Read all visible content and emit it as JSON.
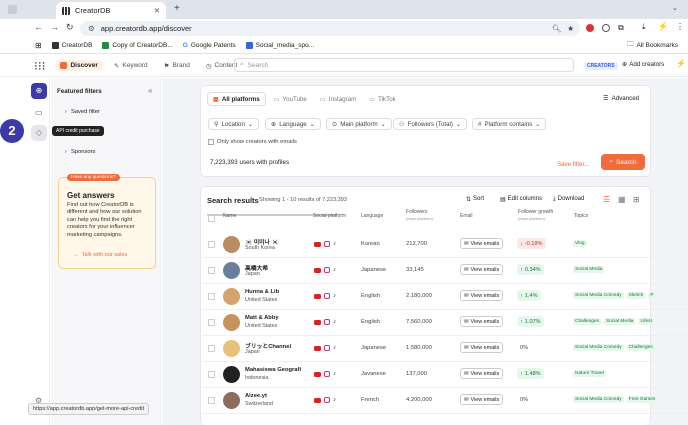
{
  "browser": {
    "tab_title": "CreatorDB",
    "new_tab": "+",
    "url": "app.creatordb.app/discover",
    "bookmarks": [
      "CreatorDB",
      "Copy of CreatorDB...",
      "Google Patents",
      "Social_media_spo..."
    ],
    "all_bookmarks": "All Bookmarks"
  },
  "nav": {
    "discover": "Discover",
    "keyword": "Keyword",
    "brand": "Brand",
    "content": "Content",
    "search_placeholder": "Search",
    "badge": "CREATORS",
    "add_creators": "Add creators"
  },
  "filters_panel": {
    "title": "Featured filters",
    "saved": "Saved filter",
    "sponsors": "Sponsors",
    "tooltip": "API credit purchase",
    "step": "2",
    "promo": {
      "badge": "Have any questions?",
      "title": "Get answers",
      "body": "Find out how CreatorDB is different and how our solution can help you find the right creators for your influencer marketing campaigns.",
      "link": "Talk with our sales"
    }
  },
  "platforms": {
    "tabs": [
      "All platforms",
      "YouTube",
      "Instagram",
      "TikTok"
    ],
    "advanced": "Advanced"
  },
  "filters": {
    "location": "Location",
    "language": "Language",
    "main_platform": "Main platform",
    "followers": "Followers (Total)",
    "platform_contains": "Platform contains",
    "emails_only": "Only show creators with emails",
    "summary_count": "7,223,393",
    "summary_text": "users with profiles",
    "save": "Save filter...",
    "search_btn": "Search"
  },
  "results": {
    "title": "Search results",
    "showing": "Showing 1 - 10 results of 7,223,393",
    "sort": "Sort",
    "edit": "Edit columns",
    "download": "Download"
  },
  "table": {
    "headers": [
      "Name",
      "Social platform",
      "Language",
      "Followers",
      "Email",
      "Follower growth",
      "Topics"
    ],
    "followers_sub": "(Main platform)",
    "growth_sub": "(Main platform)",
    "rows": [
      {
        "name": "🇰🇷 미미나 🇰🇷",
        "country": "South Korea",
        "lang": "Korean",
        "followers": "212,700",
        "email": "View emails",
        "growth": "-0.19%",
        "growth_dir": "down",
        "topics": [
          "Vlog"
        ],
        "color": "#b98c63"
      },
      {
        "name": "高橋大希",
        "country": "Japan",
        "lang": "Japanese",
        "followers": "33,145",
        "email": "View emails",
        "growth": "0.34%",
        "growth_dir": "up",
        "topics": [
          "Social Media"
        ],
        "color": "#6b7f99"
      },
      {
        "name": "Hunna & Lib",
        "country": "United States",
        "lang": "English",
        "followers": "2,180,000",
        "email": "View emails",
        "growth": "1.4%",
        "growth_dir": "up",
        "topics": [
          "Social Media Comedy",
          "Sketch",
          "P"
        ],
        "color": "#d4a36e"
      },
      {
        "name": "Matt & Abby",
        "country": "United States",
        "lang": "English",
        "followers": "7,560,000",
        "email": "View emails",
        "growth": "1.07%",
        "growth_dir": "up",
        "topics": [
          "Challenges",
          "Social Media",
          "Lifest"
        ],
        "color": "#c7935a"
      },
      {
        "name": "ブリッとChannel",
        "country": "Japan",
        "lang": "Japanese",
        "followers": "1,580,000",
        "email": "View emails",
        "growth": "0%",
        "growth_dir": "flat",
        "topics": [
          "Social Media Comedy",
          "Challenges"
        ],
        "color": "#e6c27a"
      },
      {
        "name": "Mahasiswa Geografi",
        "country": "Indonesia",
        "lang": "Javanese",
        "followers": "137,000",
        "email": "View emails",
        "growth": "1.48%",
        "growth_dir": "up",
        "topics": [
          "Nature Travel"
        ],
        "color": "#222222"
      },
      {
        "name": "Aizee.yt",
        "country": "Switzerland",
        "lang": "French",
        "followers": "4,200,000",
        "email": "View emails",
        "growth": "0%",
        "growth_dir": "flat",
        "topics": [
          "Social Media Comedy",
          "Free Games"
        ],
        "color": "#8a6d5b"
      }
    ]
  },
  "status_url": "https://app.creatordb.app/get-more-api-credit",
  "colors": {
    "accent": "#f26b3a",
    "brand_purple": "#3b3aa8"
  }
}
